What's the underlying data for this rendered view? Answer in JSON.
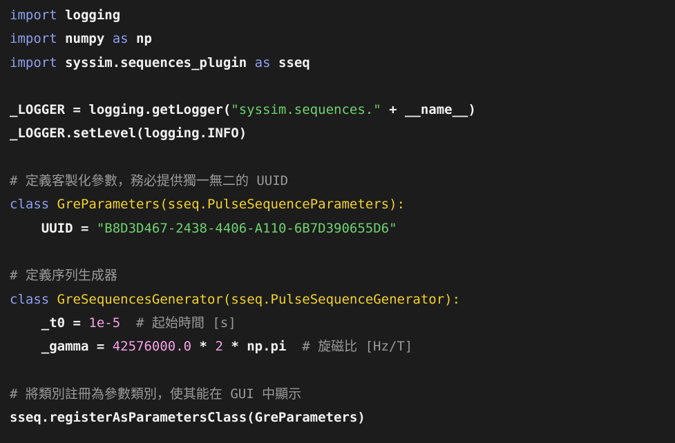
{
  "code": {
    "l1": {
      "kw": "import",
      "rest": " logging"
    },
    "l2": {
      "kw": "import",
      "a": " numpy ",
      "kw2": "as",
      "b": " np"
    },
    "l3": {
      "kw": "import",
      "a": " syssim.sequences_plugin ",
      "kw2": "as",
      "b": " sseq"
    },
    "l5": {
      "a": "_LOGGER = logging.getLogger(",
      "str": "\"syssim.sequences.\"",
      "b": " + __name__)"
    },
    "l6": {
      "a": "_LOGGER.setLevel(logging.INFO)"
    },
    "l8": {
      "cmt": "# 定義客製化參數，務必提供獨一無二的 UUID"
    },
    "l9": {
      "kw": "class",
      "sp": " ",
      "cls": "GreParameters(sseq.PulseSequenceParameters):"
    },
    "l10": {
      "a": "    UUID = ",
      "str": "\"B8D3D467-2438-4406-A110-6B7D390655D6\""
    },
    "l12": {
      "cmt": "# 定義序列生成器"
    },
    "l13": {
      "kw": "class",
      "sp": " ",
      "cls": "GreSequencesGenerator(sseq.PulseSequenceGenerator):"
    },
    "l14": {
      "a": "    _t0 = ",
      "num": "1e-5",
      "cmt": "  # 起始時間 [s]"
    },
    "l15": {
      "a": "    _gamma = ",
      "num": "42576000.0",
      "b": " * ",
      "num2": "2",
      "c": " * np.pi",
      "cmt": "  # 旋磁比 [Hz/T]"
    },
    "l17": {
      "cmt": "# 將類別註冊為參數類別，使其能在 GUI 中顯示"
    },
    "l18": {
      "a": "sseq.registerAsParametersClass(GreParameters)"
    }
  }
}
